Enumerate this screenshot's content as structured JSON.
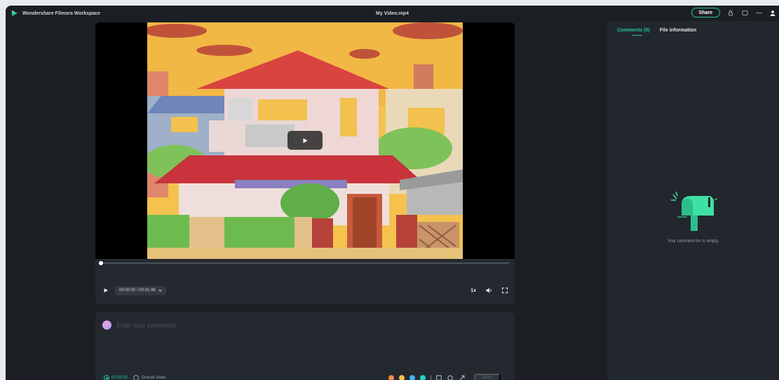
{
  "titlebar": {
    "app_title": "Wondershare Filmora Workspace",
    "doc_title": "My Video.mp4",
    "share_label": "Share"
  },
  "player": {
    "time_display": "00:00:00 / 00:01:48",
    "progress": 0.0,
    "speed_label": "1x"
  },
  "comment": {
    "placeholder": "Enter your comments",
    "time_option": "00:00:00",
    "overall_option": "Overall video",
    "swatches": [
      "#f08a4b",
      "#f5c542",
      "#37b6f6",
      "#20d7c3"
    ],
    "send_label": "Send"
  },
  "side": {
    "tab_comments": "Comments (0)",
    "tab_file_info": "File information",
    "empty_text": "Your comment bin is empty."
  },
  "colors": {
    "accent": "#20c997",
    "window_bg": "#1b1f24",
    "panel_bg": "#24292f"
  }
}
